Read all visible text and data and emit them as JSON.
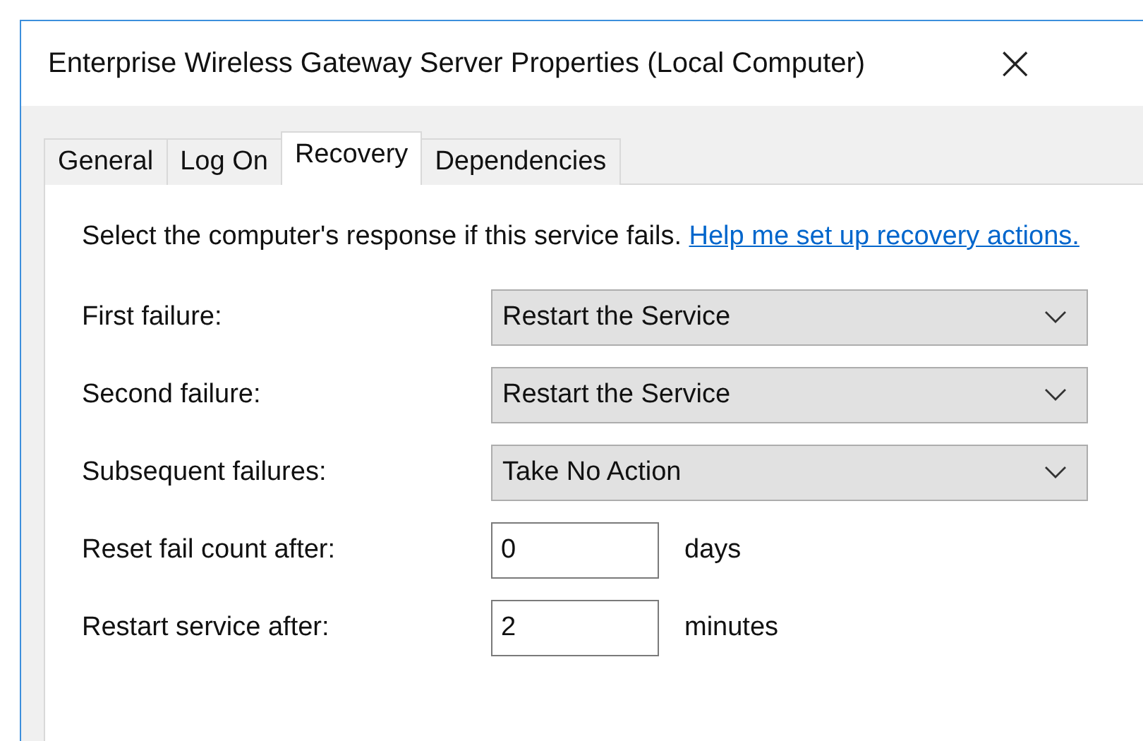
{
  "window": {
    "title": "Enterprise Wireless Gateway Server Properties (Local Computer)",
    "close": "×"
  },
  "tabs": [
    {
      "label": "General",
      "selected": false
    },
    {
      "label": "Log On",
      "selected": false
    },
    {
      "label": "Recovery",
      "selected": true
    },
    {
      "label": "Dependencies",
      "selected": false
    }
  ],
  "description": "Select the computer's response if this service fails.",
  "help_link": "Help me set up recovery actions.",
  "fields": [
    {
      "kind": "dropdown",
      "label": "First failure:",
      "value": "Restart the Service"
    },
    {
      "kind": "dropdown",
      "label": "Second failure:",
      "value": "Restart the Service"
    },
    {
      "kind": "dropdown",
      "label": "Subsequent failures:",
      "value": "Take No Action"
    },
    {
      "kind": "number",
      "label": "Reset fail count after:",
      "value": "0",
      "unit": "days"
    },
    {
      "kind": "number",
      "label": "Restart service after:",
      "value": "2",
      "unit": "minutes"
    }
  ]
}
